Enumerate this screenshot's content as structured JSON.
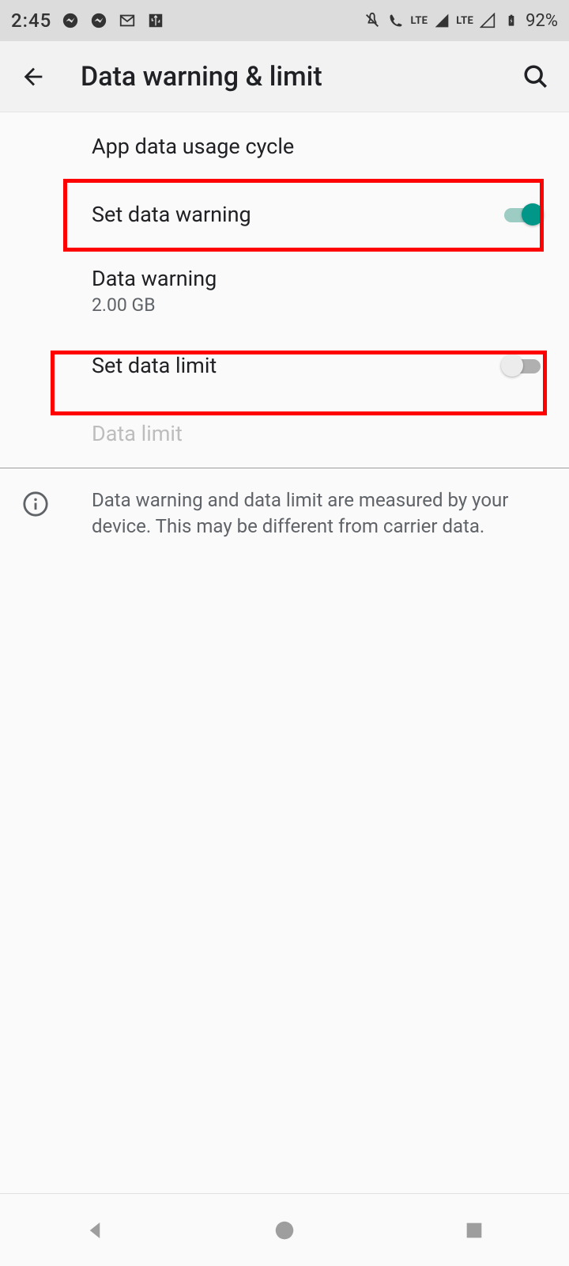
{
  "status": {
    "time": "2:45",
    "battery": "92%",
    "net_label": "LTE"
  },
  "header": {
    "title": "Data warning & limit"
  },
  "rows": {
    "cycle": {
      "title": "App data usage cycle"
    },
    "set_warning": {
      "title": "Set data warning",
      "on": true
    },
    "warning": {
      "title": "Data warning",
      "value": "2.00 GB"
    },
    "set_limit": {
      "title": "Set data limit",
      "on": false
    },
    "limit": {
      "title": "Data limit"
    }
  },
  "info": {
    "text": "Data warning and data limit are measured by your device. This may be different from carrier data."
  },
  "highlights": [
    {
      "target": "set-data-warning-row"
    },
    {
      "target": "set-data-limit-row"
    }
  ]
}
